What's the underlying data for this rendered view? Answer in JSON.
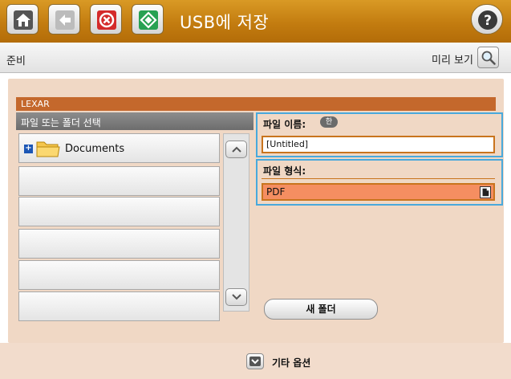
{
  "header": {
    "title": "USB에 저장",
    "icons": [
      "home-icon",
      "back-icon",
      "stop-icon",
      "start-icon",
      "help-icon"
    ]
  },
  "status": {
    "text": "준비",
    "preview_label": "미리 보기",
    "preview_icon": "magnifier-icon"
  },
  "device": {
    "name": "LEXAR"
  },
  "browser": {
    "header": "파일 또는 폴더 선택",
    "items": [
      {
        "label": "Documents",
        "icon": "folder-icon",
        "expand": "+"
      },
      {
        "label": ""
      },
      {
        "label": ""
      },
      {
        "label": ""
      },
      {
        "label": ""
      },
      {
        "label": ""
      }
    ]
  },
  "file_name": {
    "label": "파일 이름:",
    "ime_badge": "한",
    "value": "[Untitled]"
  },
  "file_type": {
    "label": "파일 형식:",
    "value": "PDF"
  },
  "new_folder_label": "새 폴더",
  "more_options_label": "기타 옵션",
  "colors": {
    "title_bar": "#c37c10",
    "accent_border": "#49a9dc",
    "device_bar": "#c4682c",
    "select_fill": "#f58e61",
    "panel": "#f0d8c5"
  }
}
